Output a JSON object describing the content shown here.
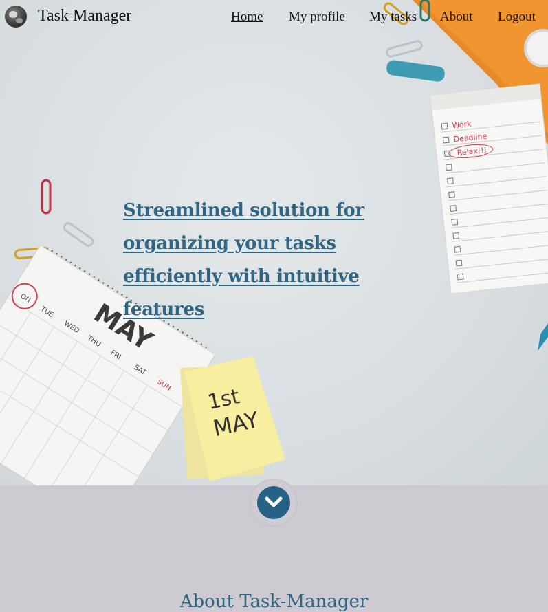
{
  "brand": {
    "name": "Task Manager",
    "logo_icon": "avatar-logo-icon"
  },
  "nav": {
    "items": [
      {
        "label": "Home",
        "active": true
      },
      {
        "label": "My profile",
        "active": false
      },
      {
        "label": "My tasks",
        "active": false
      },
      {
        "label": "About",
        "active": false
      },
      {
        "label": "Logout",
        "active": false
      }
    ]
  },
  "hero": {
    "headline": "Streamlined solution for organizing your tasks efficiently with intuitive features",
    "notepad_items": [
      "Work",
      "Deadline",
      "Relax!!!"
    ],
    "sticky_note": "1st\nMAY",
    "calendar_month": "MAY",
    "calendar_days": [
      "ON",
      "TUE",
      "WED",
      "THU",
      "FRI",
      "SAT",
      "SUN"
    ]
  },
  "scroll_button": {
    "icon": "chevron-down-icon"
  },
  "about": {
    "heading": "About Task-Manager"
  },
  "colors": {
    "accent": "#2f6683",
    "button": "#256286",
    "section_bg": "#cdcbd1"
  }
}
